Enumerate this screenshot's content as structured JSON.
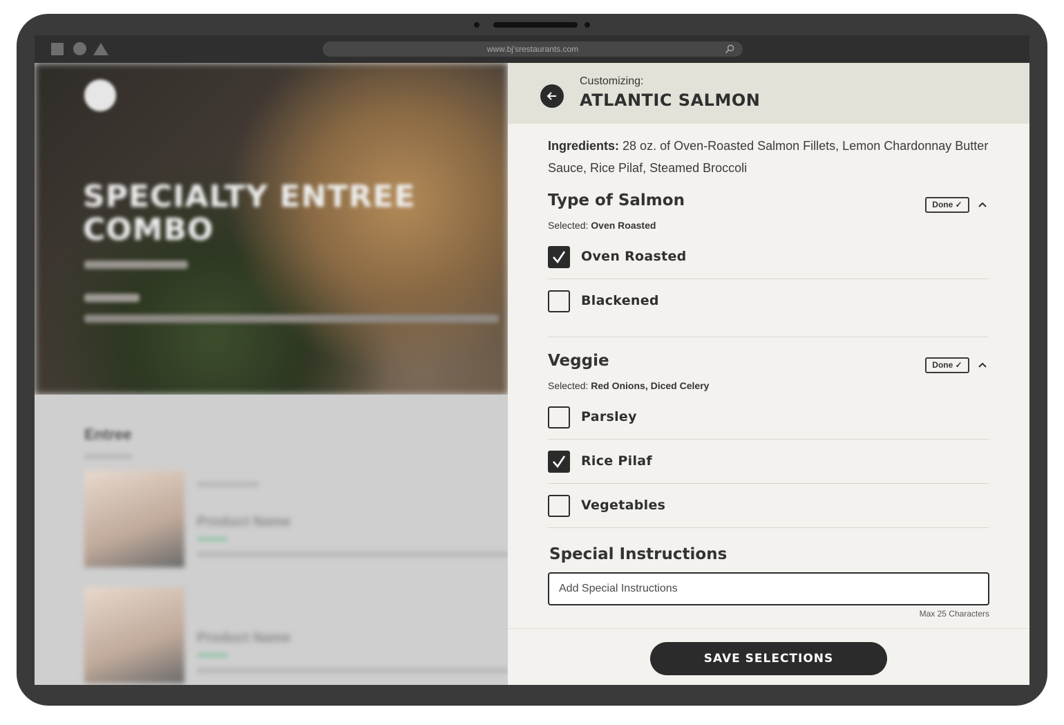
{
  "browser": {
    "url": "www.bj'srestaurants.com"
  },
  "background_page": {
    "title_line1": "SPECIALTY ENTREE",
    "title_line2": "COMBO",
    "section": "Entree",
    "product_1": "Product Name",
    "product_2": "Product Name"
  },
  "panel": {
    "customizing_label": "Customizing:",
    "item_title": "ATLANTIC SALMON",
    "ingredients_label": "Ingredients:",
    "ingredients_text": "28 oz. of Oven-Roasted Salmon Fillets, Lemon Chardonnay Butter Sauce, Rice Pilaf, Steamed Broccoli",
    "sections": [
      {
        "title": "Type of Salmon",
        "selected_label": "Selected:",
        "selected_value": "Oven Roasted",
        "done_label": "Done ✓",
        "options": [
          {
            "label": "Oven Roasted",
            "checked": true
          },
          {
            "label": "Blackened",
            "checked": false
          }
        ]
      },
      {
        "title": "Veggie",
        "selected_label": "Selected:",
        "selected_value": "Red Onions, Diced Celery",
        "done_label": "Done ✓",
        "options": [
          {
            "label": "Parsley",
            "checked": false
          },
          {
            "label": "Rice Pilaf",
            "checked": true
          },
          {
            "label": "Vegetables",
            "checked": false
          }
        ]
      }
    ],
    "special_instructions": {
      "title": "Special Instructions",
      "placeholder": "Add Special Instructions",
      "value": "",
      "max_note": "Max 25 Characters"
    },
    "save_label": "SAVE SELECTIONS"
  },
  "colors": {
    "panel_bg": "#f4f2ee",
    "header_bg": "#e3e2d8",
    "dark": "#2b2b2b"
  }
}
